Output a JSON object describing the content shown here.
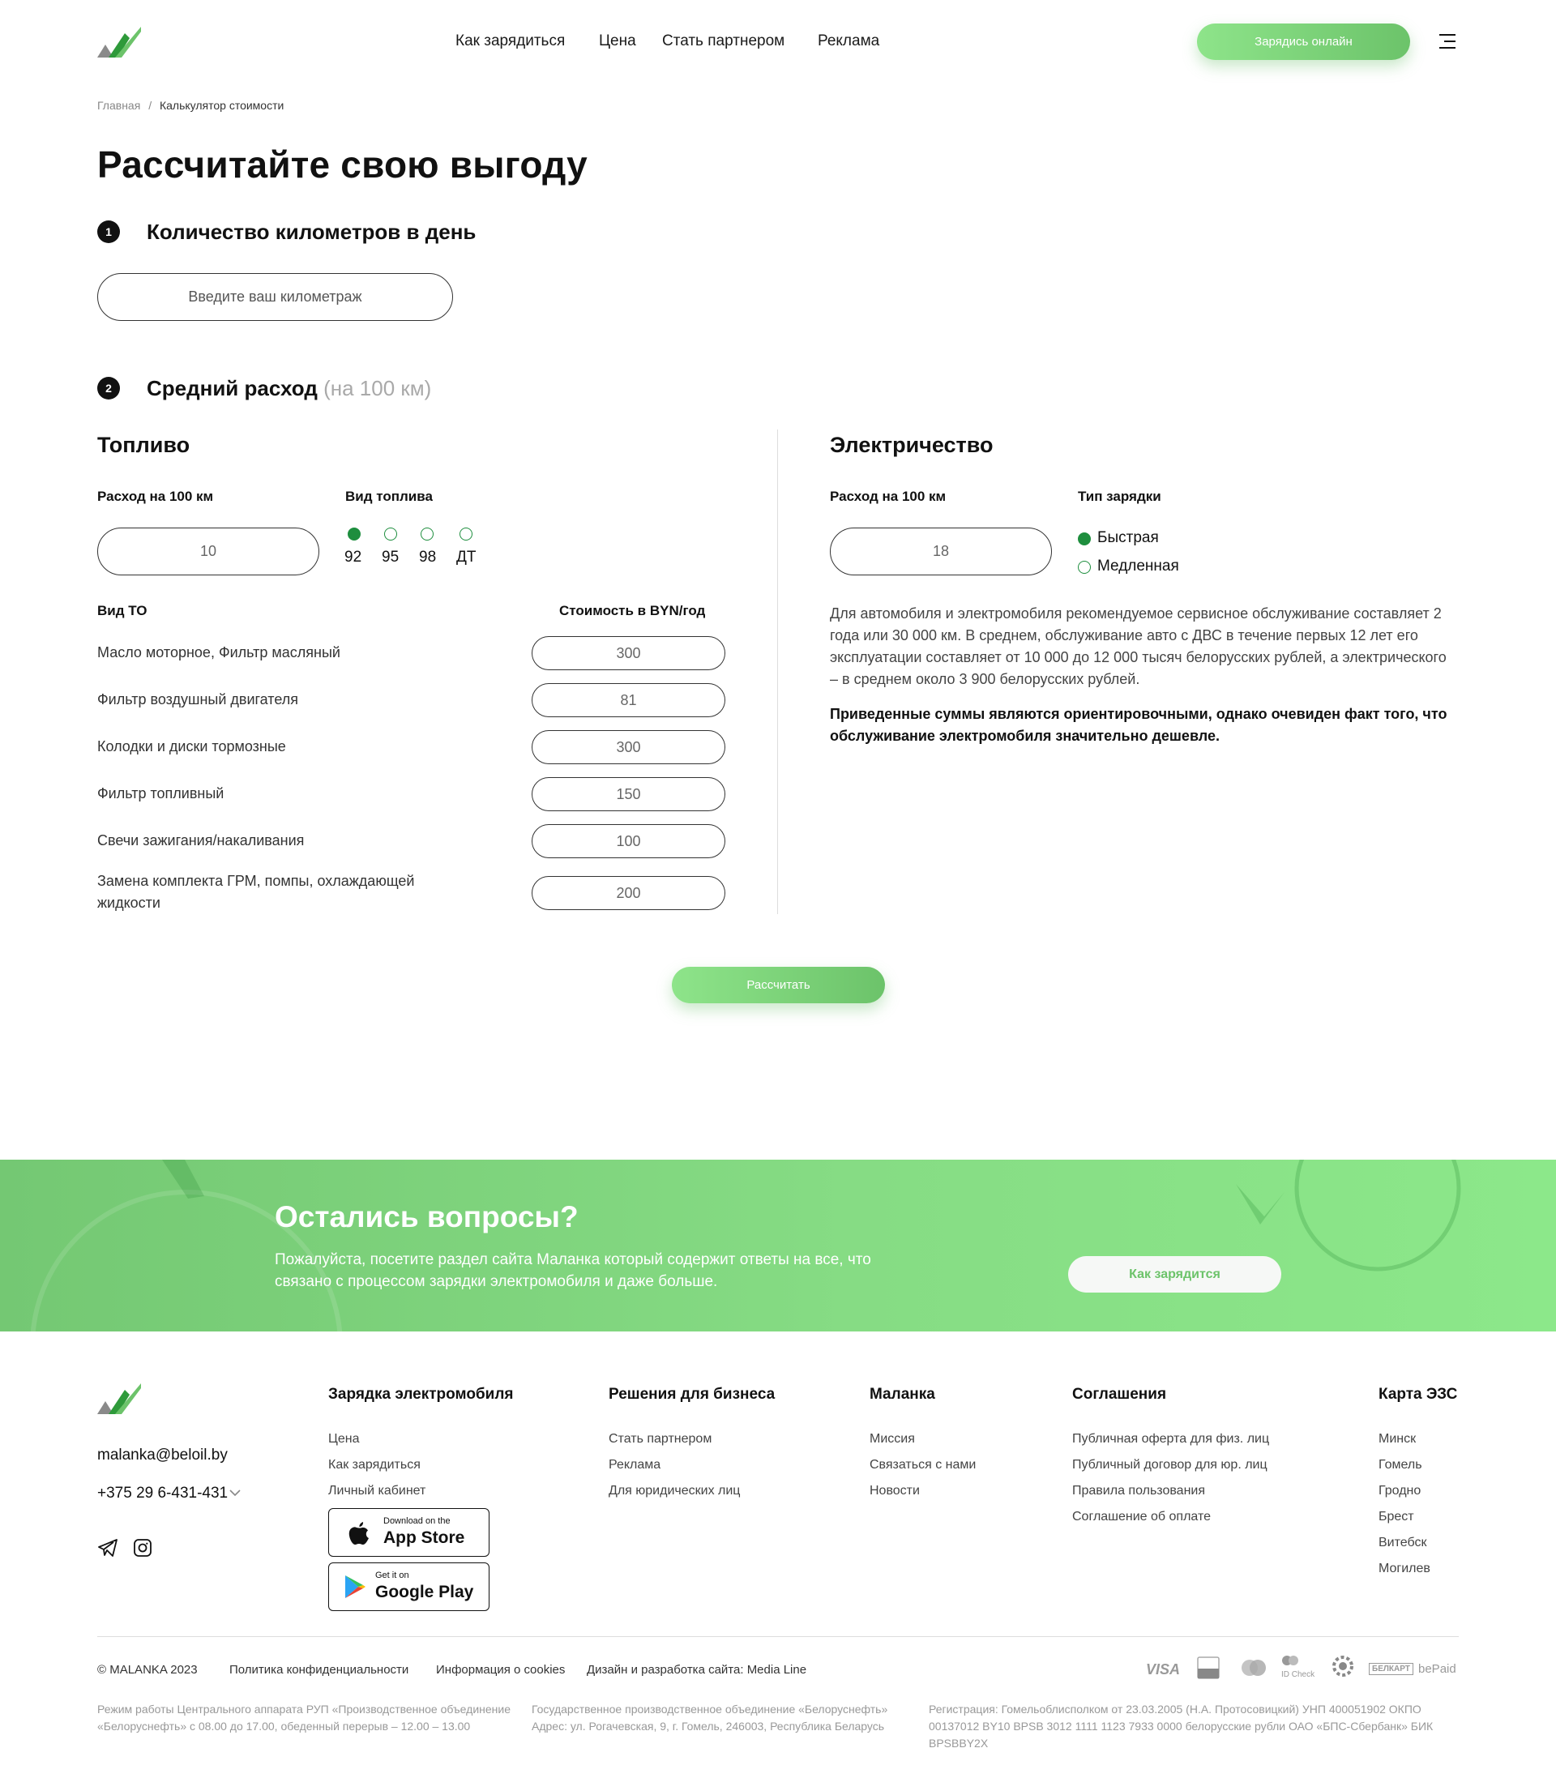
{
  "header": {
    "nav": [
      "Как зарядиться",
      "Цена",
      "Стать партнером",
      "Реклама"
    ],
    "cta": "Зарядись онлайн"
  },
  "breadcrumb": {
    "home": "Главная",
    "sep": "/",
    "current": "Калькулятор стоимости"
  },
  "title": "Рассчитайте свою выгоду",
  "step1": {
    "num": "1",
    "title": "Количество километров в день",
    "placeholder": "Введите ваш километраж"
  },
  "step2": {
    "num": "2",
    "title": "Средний расход",
    "suffix": "(на 100 км)"
  },
  "fuel": {
    "title": "Топливо",
    "consumption_label": "Расход на 100 км",
    "consumption_value": "10",
    "type_label": "Вид топлива",
    "types": [
      "92",
      "95",
      "98",
      "ДТ"
    ],
    "selected_type": "92",
    "to_label": "Вид ТО",
    "cost_label": "Стоимость в BYN/год",
    "rows": [
      {
        "name": "Масло моторное, Фильтр масляный",
        "value": "300"
      },
      {
        "name": "Фильтр воздушный двигателя",
        "value": "81"
      },
      {
        "name": "Колодки и диски тормозные",
        "value": "300"
      },
      {
        "name": "Фильтр топливный",
        "value": "150"
      },
      {
        "name": "Свечи зажигания/накаливания",
        "value": "100"
      },
      {
        "name": "Замена комплекта ГРМ, помпы, охлаждающей жидкости",
        "value": "200"
      }
    ]
  },
  "electric": {
    "title": "Электричество",
    "consumption_label": "Расход на 100 км",
    "consumption_value": "18",
    "charge_label": "Тип зарядки",
    "charge_types": [
      "Быстрая",
      "Медленная"
    ],
    "selected_charge": "Быстрая",
    "info": "Для автомобиля и электромобиля рекомендуемое сервисное обслуживание составляет 2 года или 30 000 км. В среднем, обслуживание авто с ДВС в течение первых 12 лет его эксплуатации составляет от 10 000 до 12 000 тысяч белорусских рублей, а электрического – в среднем около 3 900 белорусских рублей.",
    "note": "Приведенные суммы являются ориентировочными, однако очевиден факт того, что обслуживание электромобиля значительно дешевле."
  },
  "calculate": "Рассчитать",
  "banner": {
    "title": "Остались вопросы?",
    "text": "Пожалуйста, посетите раздел сайта Маланка который содержит ответы на все, что связано с процессом зарядки электромобиля и даже больше.",
    "button": "Как зарядится"
  },
  "footer": {
    "email": "malanka@beloil.by",
    "phone": "+375 29 6-431-431",
    "columns": [
      {
        "title": "Зарядка электромобиля",
        "links": [
          "Цена",
          "Как зарядиться",
          "Личный кабинет"
        ]
      },
      {
        "title": "Решения для бизнеса",
        "links": [
          "Стать партнером",
          "Реклама",
          "Для юридических лиц"
        ]
      },
      {
        "title": "Маланка",
        "links": [
          "Миссия",
          "Связаться с нами",
          "Новости"
        ]
      },
      {
        "title": "Соглашения",
        "links": [
          "Публичная оферта для физ. лиц",
          "Публичный договор для юр. лиц",
          "Правила пользования",
          "Соглашение об оплате"
        ]
      },
      {
        "title": "Карта ЭЗС",
        "links": [
          "Минск",
          "Гомель",
          "Гродно",
          "Брест",
          "Витебск",
          "Могилев"
        ]
      }
    ],
    "appstore": {
      "small": "Download on the",
      "big": "App Store"
    },
    "googleplay": {
      "small": "Get it on",
      "big": "Google Play"
    },
    "bottom_links": [
      "© MALANKA 2023",
      "Политика конфиденциальности",
      "Информация о cookies",
      "Дизайн и разработка сайта: Media Line"
    ],
    "payments": [
      "VISA",
      "ID Check",
      "БЕЛКАРТ",
      "bePaid"
    ],
    "legal": [
      "Режим работы Центрального аппарата РУП «Производственное объединение «Белоруснефть» с 08.00 до 17.00, обеденный перерыв – 12.00 – 13.00",
      "Государственное производственное объединение «Белоруснефть» Адрес: ул. Рогачевская, 9, г. Гомель, 246003, Республика Беларусь",
      "Регистрация: Гомельоблисполком от 23.03.2005 (Н.А. Протосовицкий) УНП 400051902 ОКПО 00137012 BY10 BPSB 3012 1111 1123 7933 0000 белорусские рубли ОАО «БПС-Сбербанк» БИК BPSBBY2X"
    ]
  },
  "colors": {
    "accent": "#6cc36a",
    "radio": "#1e8e3e"
  }
}
